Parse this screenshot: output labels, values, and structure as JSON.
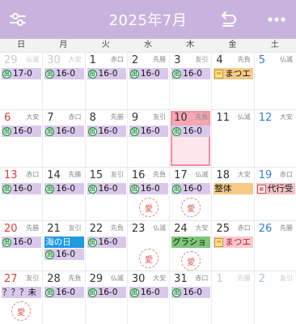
{
  "header": {
    "title": "2025年7月",
    "left_icon": "sliders-icon",
    "undo_icon": "undo-icon",
    "more_icon": "more-dots-icon"
  },
  "weekdays": [
    "日",
    "月",
    "火",
    "水",
    "木",
    "金",
    "土"
  ],
  "colors": {
    "header": "#c9b3de",
    "event_default": "#d9c8ec",
    "sunday": "#e23b3b",
    "saturday": "#2f7ed8",
    "today_border": "#f28e9f"
  },
  "weeks": [
    [
      {
        "d": "29",
        "r": "仏滅",
        "other": true,
        "ev": [
          {
            "t": "17-0",
            "c": "lav",
            "i": "g"
          }
        ]
      },
      {
        "d": "30",
        "r": "大安",
        "other": true,
        "ev": [
          {
            "t": "16-0",
            "c": "lav",
            "i": "g"
          }
        ]
      },
      {
        "d": "1",
        "r": "赤口",
        "ev": [
          {
            "t": "16-0",
            "c": "lav",
            "i": "g"
          }
        ]
      },
      {
        "d": "2",
        "r": "先勝",
        "ev": [
          {
            "t": "16-0",
            "c": "lav",
            "i": "g"
          }
        ]
      },
      {
        "d": "3",
        "r": "友引",
        "ev": [
          {
            "t": "16-0",
            "c": "lav",
            "i": "g"
          }
        ]
      },
      {
        "d": "4",
        "r": "先負",
        "ev": [
          {
            "t": "まつエ",
            "c": "orange",
            "i": "s"
          }
        ]
      },
      {
        "d": "5",
        "r": "仏滅",
        "ev": []
      }
    ],
    [
      {
        "d": "6",
        "r": "大安",
        "ev": [
          {
            "t": "16-0",
            "c": "lav",
            "i": "g"
          }
        ]
      },
      {
        "d": "7",
        "r": "赤口",
        "ev": [
          {
            "t": "16-0",
            "c": "lav",
            "i": "g"
          }
        ]
      },
      {
        "d": "8",
        "r": "先勝",
        "ev": [
          {
            "t": "16-0",
            "c": "lav",
            "i": "g"
          }
        ]
      },
      {
        "d": "9",
        "r": "友引",
        "ev": [
          {
            "t": "16-0",
            "c": "lav",
            "i": "g"
          }
        ]
      },
      {
        "d": "10",
        "r": "先負",
        "today": true,
        "ev": [
          {
            "t": "16-0",
            "c": "lav",
            "i": "g"
          }
        ]
      },
      {
        "d": "11",
        "r": "仏滅",
        "ev": []
      },
      {
        "d": "12",
        "r": "大安",
        "ev": []
      }
    ],
    [
      {
        "d": "13",
        "r": "赤口",
        "ev": [
          {
            "t": "16-0",
            "c": "lav",
            "i": "g"
          }
        ]
      },
      {
        "d": "14",
        "r": "先勝",
        "ev": [
          {
            "t": "16-0",
            "c": "lav",
            "i": "g"
          }
        ]
      },
      {
        "d": "15",
        "r": "友引",
        "ev": [
          {
            "t": "16-0",
            "c": "lav",
            "i": "g"
          }
        ]
      },
      {
        "d": "16",
        "r": "先負",
        "ev": [
          {
            "t": "16-0",
            "c": "lav",
            "i": "g"
          }
        ],
        "stamp": true
      },
      {
        "d": "17",
        "r": "仏滅",
        "ev": [
          {
            "t": "16-0",
            "c": "lav",
            "i": "g"
          }
        ],
        "stamp": true
      },
      {
        "d": "18",
        "r": "大安",
        "ev": [
          {
            "t": "整体",
            "c": "orange",
            "i": ""
          }
        ]
      },
      {
        "d": "19",
        "r": "赤口",
        "ev": [
          {
            "t": "代行受",
            "c": "pink",
            "i": "p"
          }
        ]
      }
    ],
    [
      {
        "d": "20",
        "r": "先勝",
        "ev": [
          {
            "t": "16-0",
            "c": "lav",
            "i": "g"
          }
        ]
      },
      {
        "d": "21",
        "r": "友引",
        "ev": [
          {
            "t": "海の日",
            "c": "blue",
            "i": ""
          },
          {
            "t": "16-0",
            "c": "lav",
            "i": "g"
          }
        ]
      },
      {
        "d": "22",
        "r": "先負",
        "ev": [
          {
            "t": "16-0",
            "c": "lav",
            "i": "g"
          }
        ]
      },
      {
        "d": "23",
        "r": "仏滅",
        "ev": [],
        "stamp": true
      },
      {
        "d": "24",
        "r": "大安",
        "ev": [
          {
            "t": "グラショ",
            "c": "green",
            "i": ""
          }
        ],
        "stamp": true
      },
      {
        "d": "25",
        "r": "赤口",
        "ev": [
          {
            "t": "まつエ",
            "c": "pinkb",
            "i": "s"
          }
        ]
      },
      {
        "d": "26",
        "r": "先勝",
        "ev": []
      }
    ],
    [
      {
        "d": "27",
        "r": "友引",
        "ev": [
          {
            "t": "？？？未",
            "c": "lav",
            "i": ""
          }
        ],
        "stamp": true
      },
      {
        "d": "28",
        "r": "先負",
        "ev": [
          {
            "t": "16-0",
            "c": "lav",
            "i": "g"
          }
        ]
      },
      {
        "d": "29",
        "r": "仏滅",
        "ev": [
          {
            "t": "16-0",
            "c": "lav",
            "i": "g"
          }
        ]
      },
      {
        "d": "30",
        "r": "大安",
        "ev": [
          {
            "t": "16-0",
            "c": "lav",
            "i": "g"
          }
        ]
      },
      {
        "d": "31",
        "r": "赤口",
        "ev": [
          {
            "t": "16-0",
            "c": "lav",
            "i": "g"
          }
        ]
      },
      {
        "d": "1",
        "r": "先勝",
        "other": true,
        "ev": []
      },
      {
        "d": "2",
        "r": "友引",
        "other": true,
        "ev": []
      }
    ]
  ],
  "stamp_glyph": "愛",
  "gicon_glyph": "出"
}
